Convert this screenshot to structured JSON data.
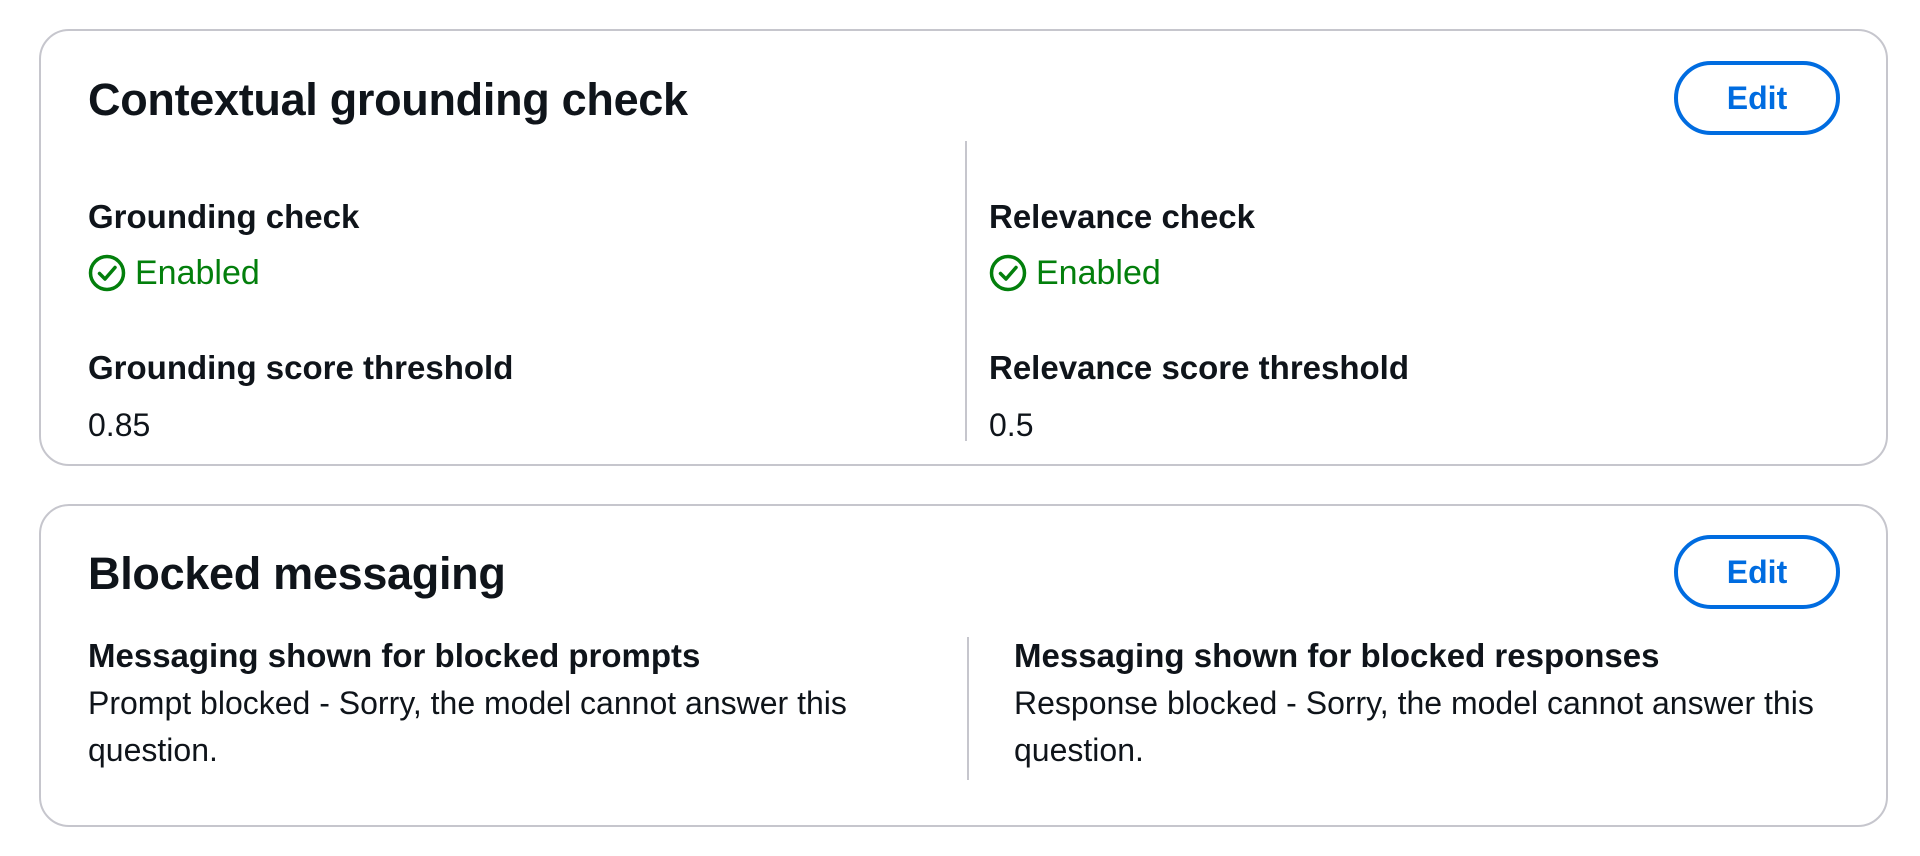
{
  "grounding_card": {
    "title": "Contextual grounding check",
    "edit_label": "Edit",
    "grounding_check": {
      "label": "Grounding check",
      "status": "Enabled",
      "threshold_label": "Grounding score threshold",
      "threshold_value": "0.85"
    },
    "relevance_check": {
      "label": "Relevance check",
      "status": "Enabled",
      "threshold_label": "Relevance score threshold",
      "threshold_value": "0.5"
    }
  },
  "blocked_card": {
    "title": "Blocked messaging",
    "edit_label": "Edit",
    "prompts": {
      "label": "Messaging shown for blocked prompts",
      "value": "Prompt blocked - Sorry, the model cannot answer this question."
    },
    "responses": {
      "label": "Messaging shown for blocked responses",
      "value": "Response blocked - Sorry, the model cannot answer this question."
    }
  },
  "colors": {
    "accent": "#006ce0",
    "success": "#037f0c",
    "border": "#c6c6cd",
    "text": "#0f141a"
  },
  "icons": {
    "status": "check-circle-icon"
  }
}
